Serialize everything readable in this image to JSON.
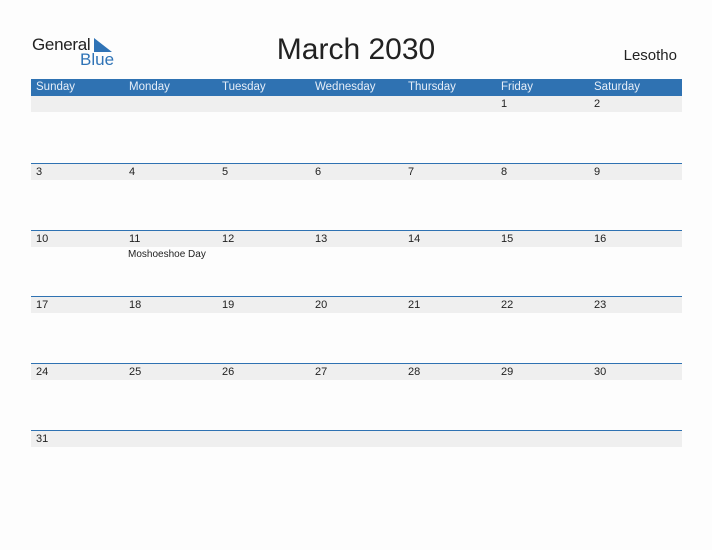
{
  "logo": {
    "general": "General",
    "blue": "Blue",
    "icon": "triangle-flag-icon"
  },
  "title": "March 2030",
  "country": "Lesotho",
  "colors": {
    "header": "#2f72b2",
    "strip": "#efefef",
    "brand_blue": "#2f73b6"
  },
  "weekdays": [
    "Sunday",
    "Monday",
    "Tuesday",
    "Wednesday",
    "Thursday",
    "Friday",
    "Saturday"
  ],
  "weeks": [
    [
      "",
      "",
      "",
      "",
      "",
      "1",
      "2"
    ],
    [
      "3",
      "4",
      "5",
      "6",
      "7",
      "8",
      "9"
    ],
    [
      "10",
      "11",
      "12",
      "13",
      "14",
      "15",
      "16"
    ],
    [
      "17",
      "18",
      "19",
      "20",
      "21",
      "22",
      "23"
    ],
    [
      "24",
      "25",
      "26",
      "27",
      "28",
      "29",
      "30"
    ],
    [
      "31",
      "",
      "",
      "",
      "",
      "",
      ""
    ]
  ],
  "events": [
    {
      "week": 2,
      "day": 1,
      "label": "Moshoeshoe Day"
    }
  ]
}
